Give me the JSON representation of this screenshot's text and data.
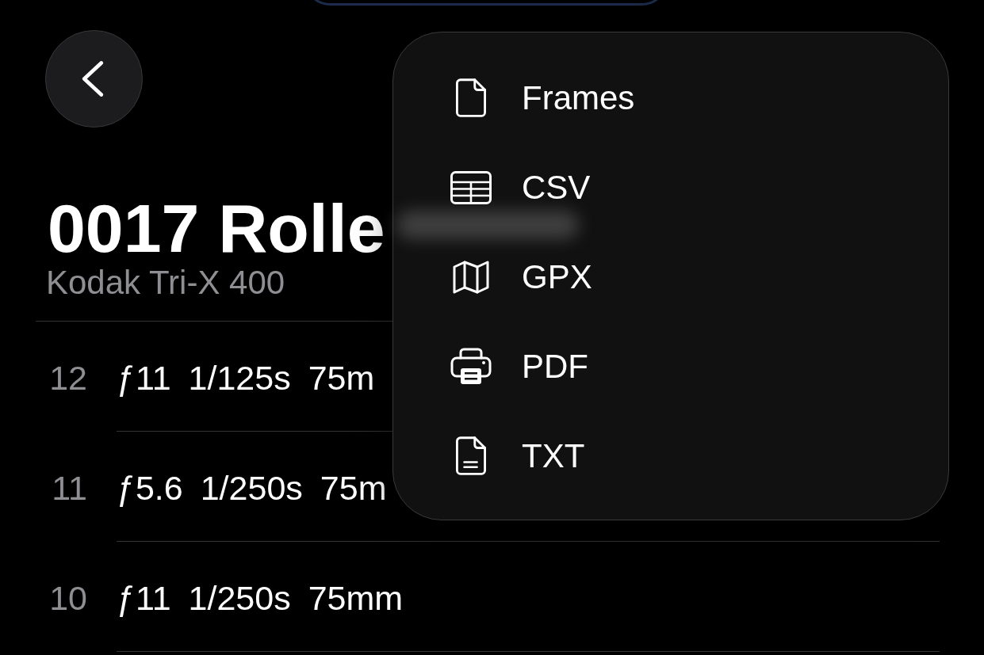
{
  "title": "0017 Rolle",
  "subtitle": "Kodak Tri-X 400",
  "frames": [
    {
      "number": "12",
      "aperture": "ƒ11",
      "shutter": "1/125s",
      "focal_length": "75m"
    },
    {
      "number": "11",
      "aperture": "ƒ5.6",
      "shutter": "1/250s",
      "focal_length": "75m"
    },
    {
      "number": "10",
      "aperture": "ƒ11",
      "shutter": "1/250s",
      "focal_length": "75mm"
    }
  ],
  "export_menu": {
    "items": [
      {
        "label": "Frames"
      },
      {
        "label": "CSV"
      },
      {
        "label": "GPX"
      },
      {
        "label": "PDF"
      },
      {
        "label": "TXT"
      }
    ]
  }
}
